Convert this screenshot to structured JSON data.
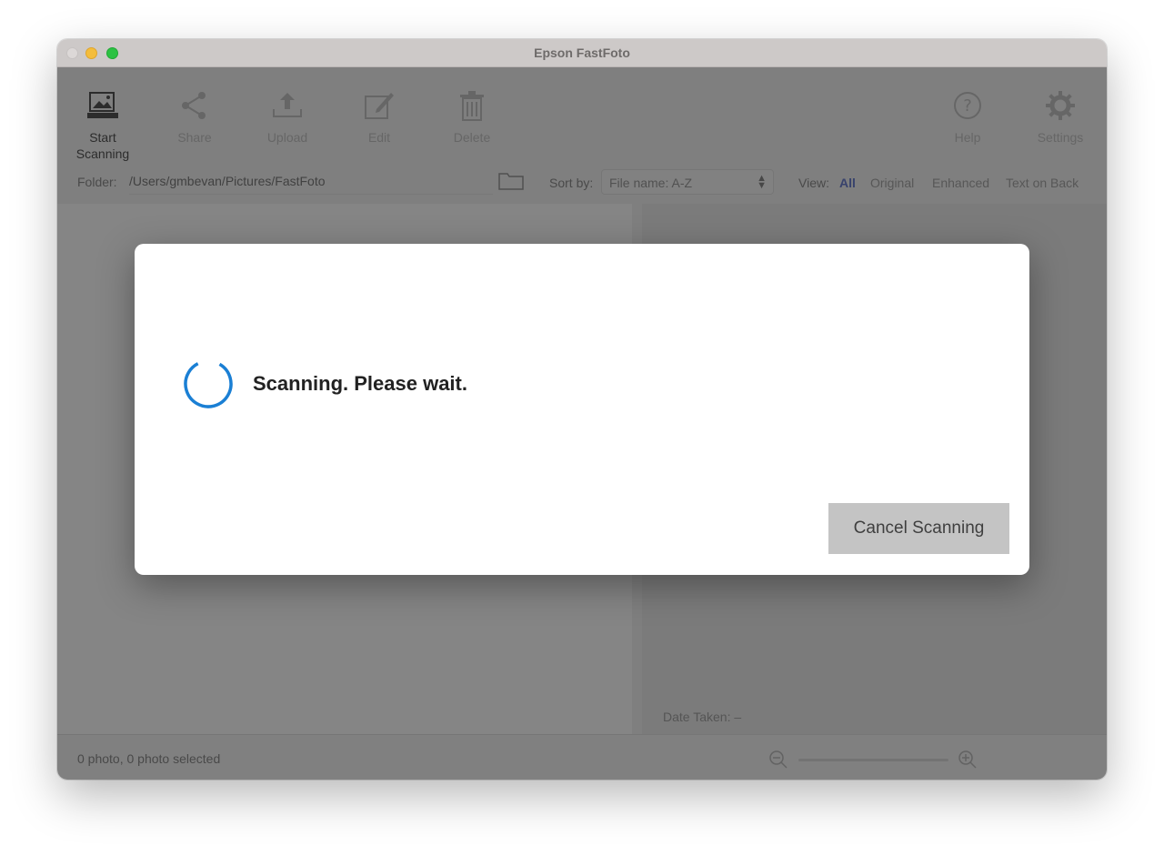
{
  "window": {
    "title": "Epson FastFoto"
  },
  "toolbar": {
    "start_scanning": "Start\nScanning",
    "start_line1": "Start",
    "start_line2": "Scanning",
    "share": "Share",
    "upload": "Upload",
    "edit": "Edit",
    "delete": "Delete",
    "help": "Help",
    "settings": "Settings"
  },
  "folder_bar": {
    "folder_label": "Folder:",
    "folder_path": "/Users/gmbevan/Pictures/FastFoto",
    "sort_label": "Sort by:",
    "sort_value": "File name: A-Z",
    "view_label": "View:",
    "view_options": [
      "All",
      "Original",
      "Enhanced",
      "Text on Back"
    ],
    "view_selected": "All"
  },
  "detail": {
    "date_taken": "Date Taken: –"
  },
  "status": {
    "text": "0 photo, 0 photo selected"
  },
  "dialog": {
    "message": "Scanning. Please wait.",
    "cancel_label": "Cancel Scanning"
  },
  "colors": {
    "spinner_accent": "#1a7fd4",
    "view_selected": "#6b7fd0",
    "cancel_button_bg": "#c4c4c4"
  }
}
